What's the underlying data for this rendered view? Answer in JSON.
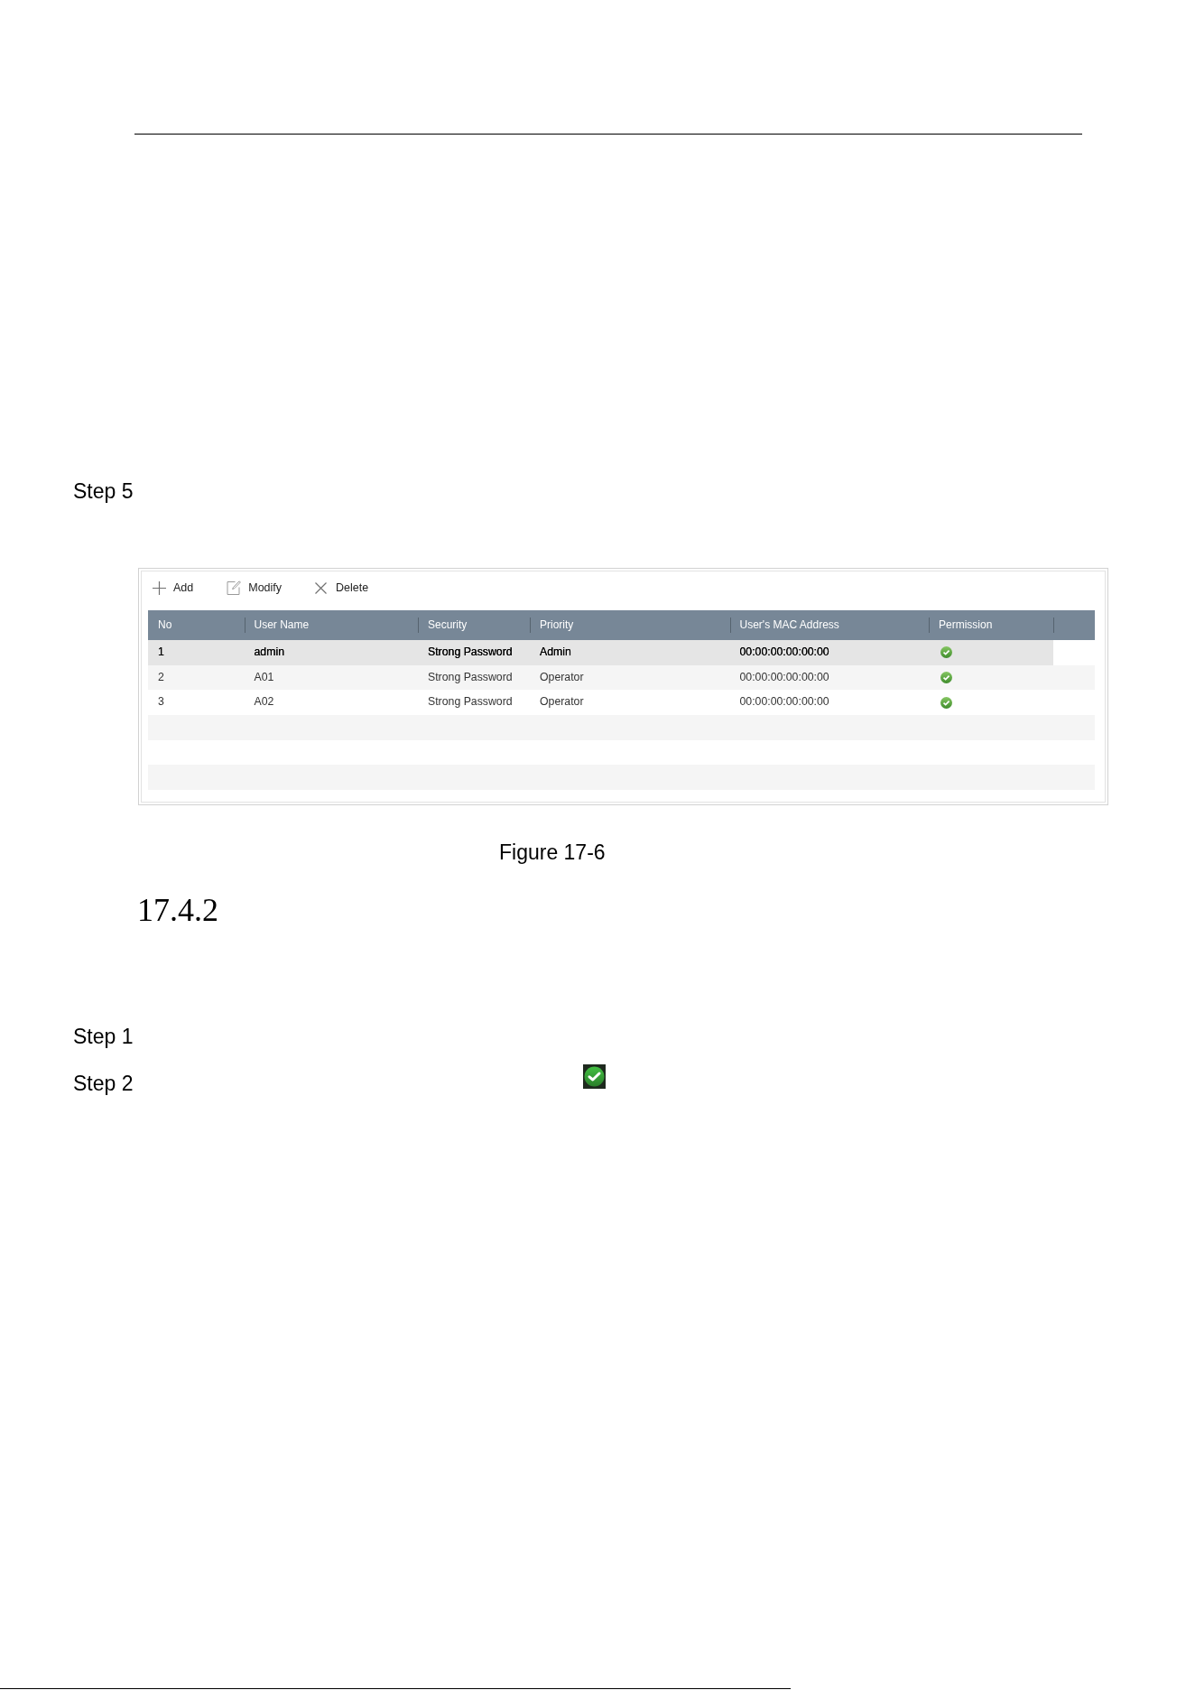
{
  "steps_above": [
    {
      "label": "Step 5"
    }
  ],
  "figure": {
    "toolbar": [
      {
        "kind": "add",
        "label": "Add"
      },
      {
        "kind": "modify",
        "label": "Modify"
      },
      {
        "kind": "delete",
        "label": "Delete"
      }
    ],
    "table": {
      "columns": [
        "No",
        "User Name",
        "Security",
        "Priority",
        "User's MAC Address",
        "Permission"
      ],
      "rows": [
        {
          "selected": true,
          "cells": [
            "1",
            "admin",
            "Strong Password",
            "Admin",
            "00:00:00:00:00:00"
          ],
          "permission": true
        },
        {
          "selected": false,
          "cells": [
            "2",
            "A01",
            "Strong Password",
            "Operator",
            "00:00:00:00:00:00"
          ],
          "permission": true
        },
        {
          "selected": false,
          "cells": [
            "3",
            "A02",
            "Strong Password",
            "Operator",
            "00:00:00:00:00:00"
          ],
          "permission": true
        },
        {
          "selected": false
        },
        {
          "selected": false
        },
        {
          "selected": false
        }
      ]
    },
    "caption": "Figure 17-6"
  },
  "section": {
    "number": "17.4.2",
    "steps": [
      {
        "label": "Step 1",
        "inline_icon": false
      },
      {
        "label": "Step 2",
        "inline_icon": true
      }
    ]
  }
}
